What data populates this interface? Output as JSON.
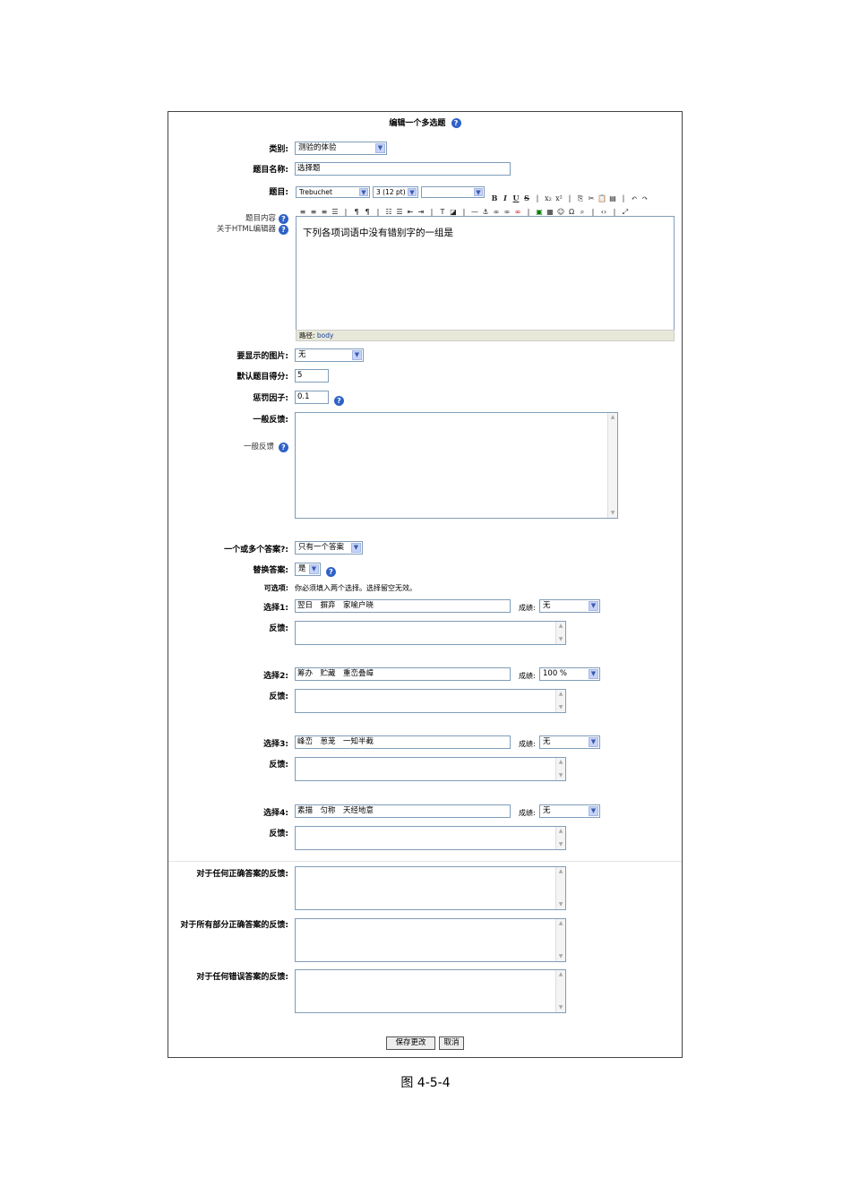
{
  "form_title": "编辑一个多选题",
  "category": {
    "label": "类别:",
    "value": "测验的体验"
  },
  "question_name": {
    "label": "题目名称:",
    "value": "选择题"
  },
  "question_text": {
    "label": "题目:",
    "help_content": "题目内容",
    "help_html_editor": "关于HTML编辑器",
    "font": "Trebuchet",
    "size": "3 (12 pt)",
    "style": "",
    "content": "下列各项词语中没有错别字的一组是",
    "path_label": "路径:",
    "path_value": "body"
  },
  "image": {
    "label": "要显示的图片:",
    "value": "无"
  },
  "default_grade": {
    "label": "默认题目得分:",
    "value": "5"
  },
  "penalty": {
    "label": "惩罚因子:",
    "value": "0.1"
  },
  "general_feedback": {
    "label": "一般反馈:",
    "help": "一般反馈"
  },
  "single_answer": {
    "label": "一个或多个答案?:",
    "value": "只有一个答案"
  },
  "shuffle": {
    "label": "替换答案:",
    "value": "是"
  },
  "choices_note": {
    "label": "可选项:",
    "text": "你必须填入两个选择。选择留空无效。"
  },
  "choices": [
    {
      "label": "选择1:",
      "value": "翌日　摒弃　家喻户晓",
      "grade_label": "成绩:",
      "grade": "无",
      "feedback_label": "反馈:"
    },
    {
      "label": "选择2:",
      "value": "筹办　贮藏　重峦叠嶂",
      "grade_label": "成绩:",
      "grade": "100 %",
      "feedback_label": "反馈:"
    },
    {
      "label": "选择3:",
      "value": "峰峦　葱茏　一知半截",
      "grade_label": "成绩:",
      "grade": "无",
      "feedback_label": "反馈:"
    },
    {
      "label": "选择4:",
      "value": "素描　匀称　天经地意",
      "grade_label": "成绩:",
      "grade": "无",
      "feedback_label": "反馈:"
    }
  ],
  "overall_feedback": {
    "correct": "对于任何正确答案的反馈:",
    "partial": "对于所有部分正确答案的反馈:",
    "incorrect": "对于任何错误答案的反馈:"
  },
  "buttons": {
    "save": "保存更改",
    "cancel": "取消"
  },
  "figure_caption": "图 4-5-4"
}
